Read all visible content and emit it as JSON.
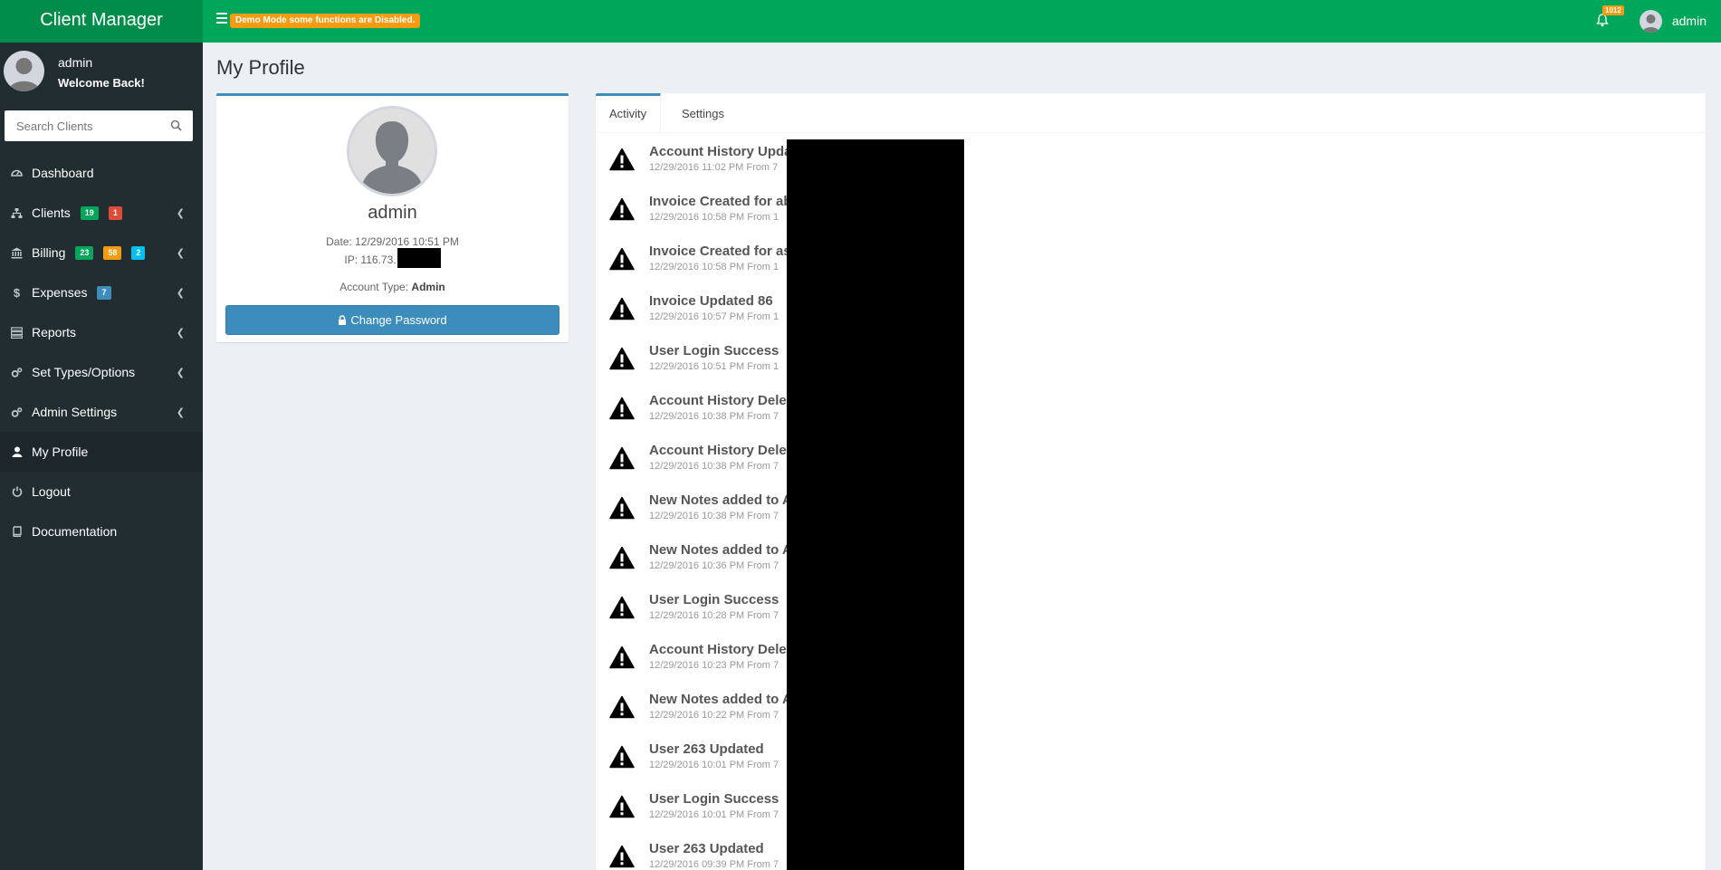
{
  "app": {
    "title": "Client Manager"
  },
  "header": {
    "demo_notice": "Demo Mode some functions are Disabled.",
    "notification_count": "1012",
    "user_name": "admin"
  },
  "sidebar": {
    "user_name": "admin",
    "welcome": "Welcome Back!",
    "search_placeholder": "Search Clients",
    "items": [
      {
        "label": "Dashboard",
        "icon": "dashboard-icon"
      },
      {
        "label": "Clients",
        "icon": "sitemap-icon",
        "badges": [
          "19",
          "1"
        ]
      },
      {
        "label": "Billing",
        "icon": "bank-icon",
        "badges": [
          "23",
          "58",
          "2"
        ]
      },
      {
        "label": "Expenses",
        "icon": "dollar-icon",
        "badges": [
          "7"
        ]
      },
      {
        "label": "Reports",
        "icon": "list-icon"
      },
      {
        "label": "Set Types/Options",
        "icon": "cogs-icon"
      },
      {
        "label": "Admin Settings",
        "icon": "cogs-icon"
      },
      {
        "label": "My Profile",
        "icon": "user-icon",
        "active": true
      },
      {
        "label": "Logout",
        "icon": "power-icon"
      },
      {
        "label": "Documentation",
        "icon": "book-icon"
      }
    ]
  },
  "page": {
    "title": "My Profile"
  },
  "profile": {
    "name": "admin",
    "date": "Date: 12/29/2016 10:51 PM",
    "ip": "IP: 116.73.",
    "account_type_label": "Account Type:",
    "account_type_value": "Admin",
    "change_password_label": "Change Password"
  },
  "tabs": {
    "activity": "Activity",
    "settings": "Settings"
  },
  "activity": [
    {
      "title": "Account History Updat",
      "meta": "12/29/2016 11:02 PM From 7"
    },
    {
      "title": "Invoice Created for ab",
      "meta": "12/29/2016 10:58 PM From 1"
    },
    {
      "title": "Invoice Created for as",
      "meta": "12/29/2016 10:58 PM From 1"
    },
    {
      "title": "Invoice Updated 86",
      "meta": "12/29/2016 10:57 PM From 1"
    },
    {
      "title": "User Login Success",
      "meta": "12/29/2016 10:51 PM From 1"
    },
    {
      "title": "Account History Delete",
      "meta": "12/29/2016 10:38 PM From 7"
    },
    {
      "title": "Account History Delete",
      "meta": "12/29/2016 10:38 PM From 7"
    },
    {
      "title": "New Notes added to A",
      "meta": "12/29/2016 10:38 PM From 7"
    },
    {
      "title": "New Notes added to A",
      "meta": "12/29/2016 10:36 PM From 7"
    },
    {
      "title": "User Login Success",
      "meta": "12/29/2016 10:28 PM From 7"
    },
    {
      "title": "Account History Delete",
      "meta": "12/29/2016 10:23 PM From 7"
    },
    {
      "title": "New Notes added to A",
      "meta": "12/29/2016 10:22 PM From 7"
    },
    {
      "title": "User 263 Updated",
      "meta": "12/29/2016 10:01 PM From 7"
    },
    {
      "title": "User Login Success",
      "meta": "12/29/2016 10:01 PM From 7"
    },
    {
      "title": "User 263 Updated",
      "meta": "12/29/2016 09:39 PM From 7"
    }
  ],
  "colors": {
    "header_green": "#00a65a",
    "logo_green": "#008d4c",
    "sidebar_bg": "#222d32",
    "primary_blue": "#3c8dbc",
    "badge_yellow": "#f39c12",
    "badge_red": "#dd4b39",
    "badge_aqua": "#00c0ef"
  }
}
